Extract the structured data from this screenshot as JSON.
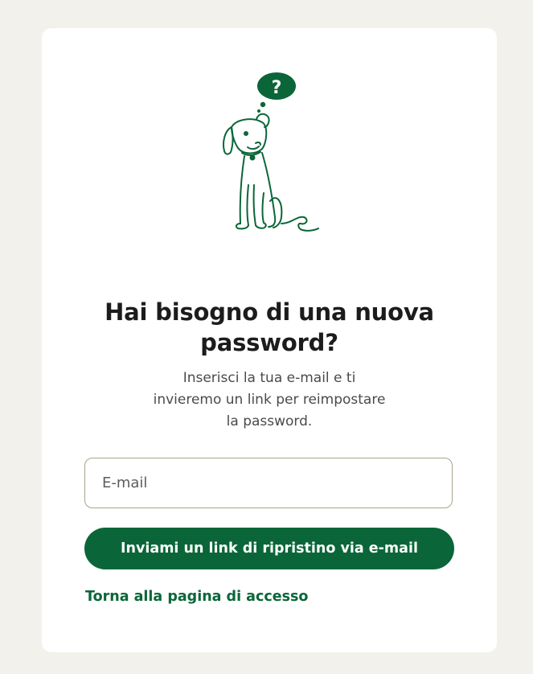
{
  "illustration": {
    "icon": "dog-with-question-mark-icon",
    "bubble_text": "?",
    "color": "#0a6638"
  },
  "reset": {
    "title": "Hai bisogno di una nuova password?",
    "subtitle": "Inserisci la tua e-mail e ti invieremo un link per reimpostare la password.",
    "email_placeholder": "E-mail",
    "submit_label": "Inviami un link di ripristino via e-mail",
    "back_link_label": "Torna alla pagina di accesso"
  },
  "colors": {
    "background": "#f3f1ec",
    "card": "#ffffff",
    "accent": "#0a6638",
    "text": "#1c1c1c"
  }
}
